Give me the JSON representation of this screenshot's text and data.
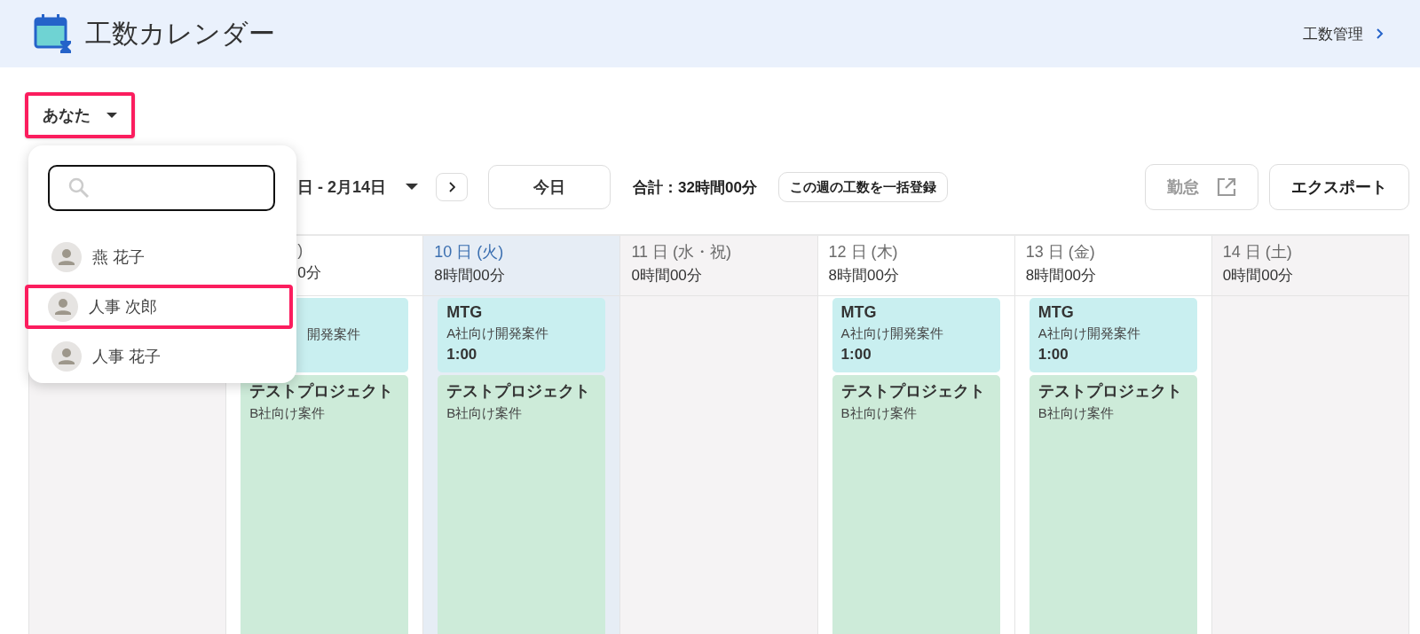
{
  "header": {
    "title": "工数カレンダー",
    "link": "工数管理"
  },
  "user_selector": {
    "label": "あなた",
    "highlighted": true
  },
  "user_menu": {
    "items": [
      {
        "name": "燕 花子",
        "highlighted": false
      },
      {
        "name": "人事 次郎",
        "highlighted": true
      },
      {
        "name": "人事 花子",
        "highlighted": false
      }
    ]
  },
  "toolbar": {
    "date_range": "日 - 2月14日",
    "today": "今日",
    "total": "合計：32時間00分",
    "bulk_register": "この週の工数を一括登録",
    "attendance": {
      "label": "勤怠",
      "disabled": true
    },
    "export": "エクスポート"
  },
  "columns": [
    {
      "kind": "weekend"
    },
    {
      "kind": "weekday",
      "partial": true,
      "day": ")",
      "hours": "0分",
      "events": [
        {
          "kind": "meeting",
          "subtitle": "開発案件"
        },
        {
          "kind": "project",
          "title": "テストプロジェクト",
          "subtitle": "B社向け案件"
        }
      ]
    },
    {
      "kind": "today",
      "partial": false,
      "day": "10 日 (火)",
      "hours": "8時間00分",
      "events": [
        {
          "kind": "meeting",
          "title": "MTG",
          "subtitle": "A社向け開発案件",
          "duration": "1:00"
        },
        {
          "kind": "project",
          "title": "テストプロジェクト",
          "subtitle": "B社向け案件"
        }
      ]
    },
    {
      "kind": "holiday",
      "partial": false,
      "day": "11 日 (水・祝)",
      "hours": "0時間00分"
    },
    {
      "kind": "weekday",
      "partial": false,
      "day": "12 日 (木)",
      "hours": "8時間00分",
      "events": [
        {
          "kind": "meeting",
          "title": "MTG",
          "subtitle": "A社向け開発案件",
          "duration": "1:00"
        },
        {
          "kind": "project",
          "title": "テストプロジェクト",
          "subtitle": "B社向け案件"
        }
      ]
    },
    {
      "kind": "weekday",
      "partial": false,
      "day": "13 日 (金)",
      "hours": "8時間00分",
      "events": [
        {
          "kind": "meeting",
          "title": "MTG",
          "subtitle": "A社向け開発案件",
          "duration": "1:00"
        },
        {
          "kind": "project",
          "title": "テストプロジェクト",
          "subtitle": "B社向け案件"
        }
      ]
    },
    {
      "kind": "weekend",
      "partial": false,
      "day": "14 日 (土)",
      "hours": "0時間00分"
    }
  ]
}
